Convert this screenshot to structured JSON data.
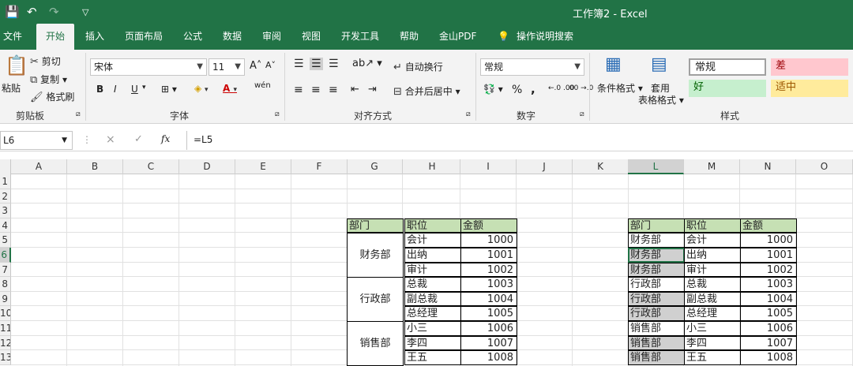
{
  "window": {
    "title": "工作簿2  -  Excel"
  },
  "quick_access": {
    "save": "💾",
    "undo": "↶",
    "redo": "↷",
    "custom": "▽"
  },
  "tabs": [
    "文件",
    "开始",
    "插入",
    "页面布局",
    "公式",
    "数据",
    "审阅",
    "视图",
    "开发工具",
    "帮助",
    "金山PDF",
    "操作说明搜索"
  ],
  "ribbon": {
    "clipboard": {
      "paste": "粘贴",
      "cut": "剪切",
      "copy": "复制",
      "format_painter": "格式刷",
      "label": "剪贴板"
    },
    "font": {
      "name": "宋体",
      "size": "11",
      "grow": "A˄",
      "shrink": "A˅",
      "bold": "B",
      "italic": "I",
      "underline": "U",
      "phonetic": "wén",
      "label": "字体"
    },
    "alignment": {
      "wrap": "自动换行",
      "merge": "合并后居中",
      "label": "对齐方式"
    },
    "number": {
      "format": "常规",
      "percent": "%",
      "comma": ",",
      "inc_dec": "←.0 .00",
      "dec_dec": ".00 →.0",
      "label": "数字"
    },
    "styles": {
      "cond_format": "条件格式",
      "table_format_1": "套用",
      "table_format_2": "表格格式",
      "normal": "常规",
      "bad": "差",
      "good": "好",
      "neutral": "适中",
      "label": "样式"
    }
  },
  "formula_bar": {
    "name_box": "L6",
    "fx": "fx",
    "formula": "=L5",
    "cancel": "×",
    "enter": "✓"
  },
  "columns": [
    "A",
    "B",
    "C",
    "D",
    "E",
    "F",
    "G",
    "H",
    "I",
    "J",
    "K",
    "L",
    "M",
    "N",
    "O"
  ],
  "rows": [
    "1",
    "2",
    "3",
    "4",
    "5",
    "6",
    "7",
    "8",
    "9",
    "10",
    "11",
    "12",
    "13"
  ],
  "table_left": {
    "headers": [
      "部门",
      "职位",
      "金额"
    ],
    "groups": [
      "财务部",
      "行政部",
      "销售部"
    ],
    "positions": [
      "会计",
      "出纳",
      "审计",
      "总裁",
      "副总裁",
      "总经理",
      "小三",
      "李四",
      "王五"
    ],
    "amounts": [
      "1000",
      "1001",
      "1002",
      "1003",
      "1004",
      "1005",
      "1006",
      "1007",
      "1008"
    ]
  },
  "table_right": {
    "headers": [
      "部门",
      "职位",
      "金额"
    ],
    "depts": [
      "财务部",
      "财务部",
      "财务部",
      "行政部",
      "行政部",
      "行政部",
      "销售部",
      "销售部",
      "销售部"
    ],
    "positions": [
      "会计",
      "出纳",
      "审计",
      "总裁",
      "副总裁",
      "总经理",
      "小三",
      "李四",
      "王五"
    ],
    "amounts": [
      "1000",
      "1001",
      "1002",
      "1003",
      "1004",
      "1005",
      "1006",
      "1007",
      "1008"
    ]
  },
  "colors": {
    "excel_green": "#217346",
    "header_fill": "#c6e0b4",
    "gray_fill": "#d0d0d0",
    "bad": "#ffc7ce",
    "good": "#c6efce",
    "neutral": "#ffeb9c"
  }
}
